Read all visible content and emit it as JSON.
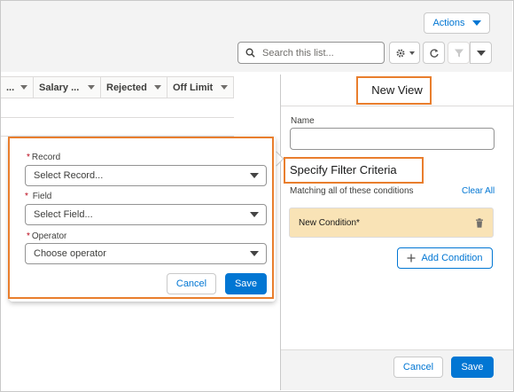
{
  "toolbar": {
    "actions_label": "Actions",
    "search_placeholder": "Search this list..."
  },
  "table": {
    "columns": [
      {
        "label": "..."
      },
      {
        "label": "Salary ..."
      },
      {
        "label": "Rejected"
      },
      {
        "label": "Off Limit"
      }
    ]
  },
  "panel": {
    "title": "New View",
    "name_label": "Name",
    "name_value": "",
    "criteria_title": "Specify Filter Criteria",
    "matching_text": "Matching all of these conditions",
    "clear_all": "Clear All",
    "condition_label": "New Condition*",
    "add_condition": "Add Condition",
    "cancel": "Cancel",
    "save": "Save"
  },
  "popover": {
    "record_label": "Record",
    "record_placeholder": "Select Record...",
    "field_label": "Field",
    "field_placeholder": "Select Field...",
    "operator_label": "Operator",
    "operator_placeholder": "Choose operator",
    "required_mark": "*",
    "cancel": "Cancel",
    "save": "Save"
  },
  "colors": {
    "brand": "#0176d3",
    "highlight": "#e97e2d",
    "condition_bg": "#f9e3b6"
  },
  "icons": [
    "search-icon",
    "gear-icon",
    "refresh-icon",
    "filter-icon",
    "chevron-down-icon",
    "delete-icon",
    "plus-icon"
  ]
}
